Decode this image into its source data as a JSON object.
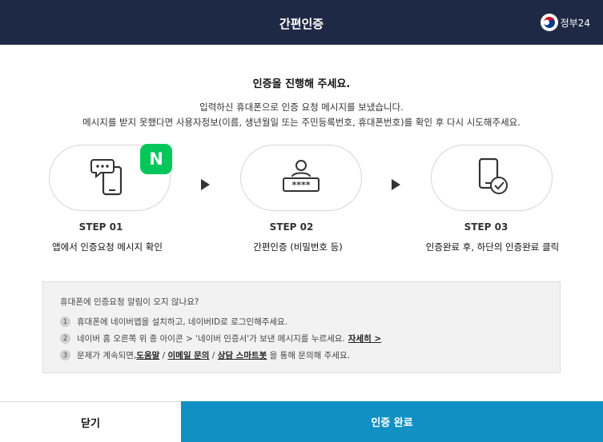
{
  "header": {
    "title": "간편인증",
    "logo_text": "정부24"
  },
  "main": {
    "heading": "인증을 진행해 주세요.",
    "desc_line1": "입력하신 휴대폰으로 인증 요청 메시지를 보냈습니다.",
    "desc_line2": "메시지를 받지 못했다면 사용자정보(이름, 생년월일 또는 주민등록번호, 휴대폰번호)를 확인 후 다시 시도해주세요."
  },
  "steps": [
    {
      "number": "STEP 01",
      "desc": "앱에서 인증요청 메시지 확인",
      "icon": "phone-message-icon"
    },
    {
      "number": "STEP 02",
      "desc": "간편인증 (비밀번호 등)",
      "icon": "user-password-icon"
    },
    {
      "number": "STEP 03",
      "desc": "인증완료 후, 하단의 인증완료 클릭",
      "icon": "phone-check-icon"
    }
  ],
  "badge": {
    "letter": "N",
    "color": "#03c75a"
  },
  "help": {
    "title": "휴대폰에 인증요청 알림이 오지 않나요?",
    "items": [
      {
        "num": "1",
        "text": "휴대폰에 네이버앱을 설치하고, 네이버ID로 로그인해주세요."
      },
      {
        "num": "2",
        "text_pre": "네이버 홈 오른쪽 위 종 아이콘 > '네이버 인증서'가 보낸 메시지를 누르세요.",
        "link": "자세히 >"
      },
      {
        "num": "3",
        "text_pre": "문제가 계속되면,",
        "link1": "도움말",
        "sep1": " / ",
        "link2": "이메일 문의",
        "sep2": " / ",
        "link3": "상담 스마트봇",
        "text_post": " 을 통해 문의해 주세요."
      }
    ]
  },
  "footer": {
    "close_label": "닫기",
    "complete_label": "인증 완료"
  },
  "colors": {
    "header_bg": "#1e2a45",
    "primary": "#1190c4",
    "naver_green": "#03c75a"
  }
}
